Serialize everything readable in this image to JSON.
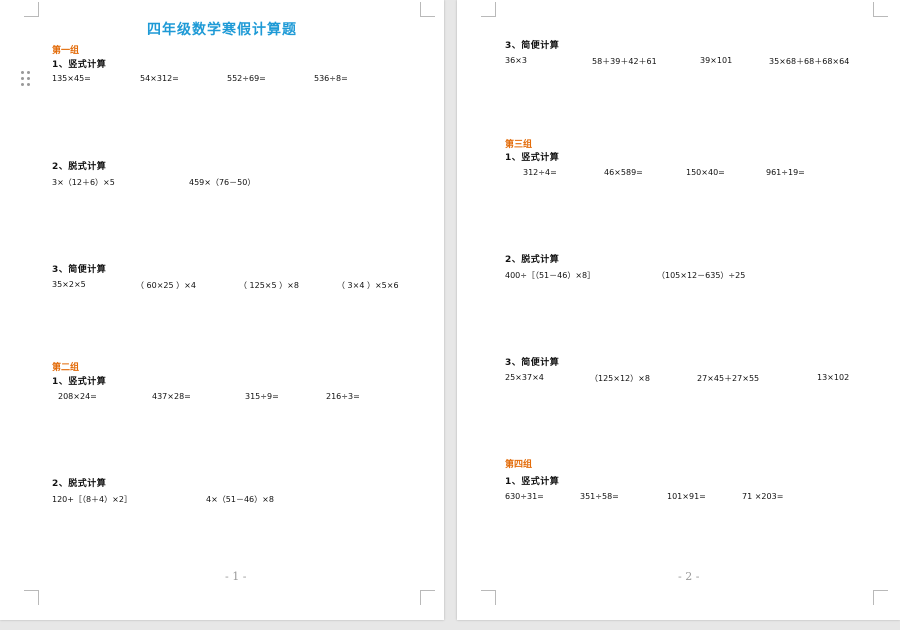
{
  "title": "四年级数学寒假计算题",
  "pages": [
    {
      "page_number": "- 1 -",
      "groups": [
        {
          "label": "第一组",
          "sections": [
            {
              "heading": "1、竖式计算",
              "problems": [
                "135×45=",
                "54×312=",
                "552÷69=",
                "536÷8="
              ]
            },
            {
              "heading": "2、脱式计算",
              "problems": [
                "3×（12＋6）×5",
                "459×（76－50）"
              ]
            },
            {
              "heading": "3、简便计算",
              "problems": [
                "35×2×5",
                "（ 60×25 ）×4",
                "（ 125×5 ）×8",
                "（ 3×4 ）×5×6"
              ]
            }
          ]
        },
        {
          "label": "第二组",
          "sections": [
            {
              "heading": "1、竖式计算",
              "problems": [
                "208×24=",
                "437×28=",
                "315÷9=",
                "216÷3="
              ]
            },
            {
              "heading": "2、脱式计算",
              "problems": [
                "120+［（8＋4）×2］",
                "4×（51－46）×8"
              ]
            }
          ]
        }
      ]
    },
    {
      "page_number": "- 2 -",
      "groups": [
        {
          "label": "",
          "sections": [
            {
              "heading": "3、简便计算",
              "problems": [
                "36×3",
                "58＋39＋42＋61",
                "39×101",
                "35×68＋68＋68×64"
              ]
            }
          ]
        },
        {
          "label": "第三组",
          "sections": [
            {
              "heading": "1、竖式计算",
              "problems": [
                "312÷4=",
                "46×589=",
                "150×40=",
                "961÷19="
              ]
            },
            {
              "heading": "2、脱式计算",
              "problems": [
                "400÷［（51－46）×8］",
                "（105×12－635）÷25"
              ]
            },
            {
              "heading": "3、简便计算",
              "problems": [
                "25×37×4",
                "（125×12）×8",
                "27×45＋27×55",
                "13×102"
              ]
            }
          ]
        },
        {
          "label": "第四组",
          "sections": [
            {
              "heading": "1、竖式计算",
              "problems": [
                "630÷31=",
                "351÷58=",
                "101×91=",
                "71 ×203="
              ]
            }
          ]
        }
      ]
    }
  ]
}
